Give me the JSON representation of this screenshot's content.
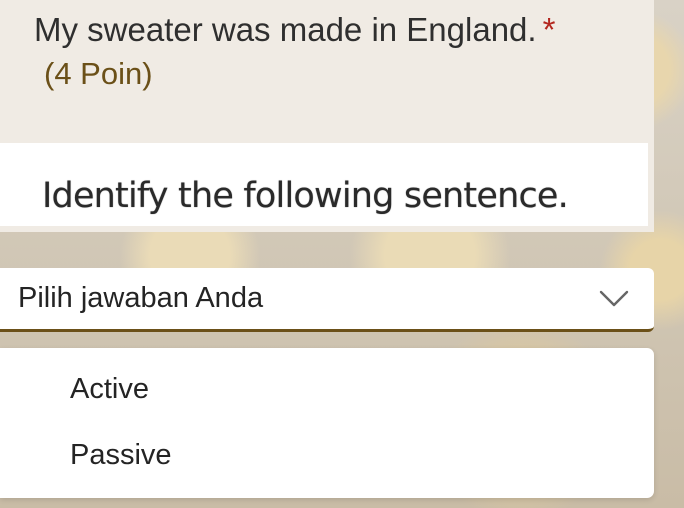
{
  "question": {
    "text": "My sweater was made in England.",
    "required_marker": "*",
    "points": "(4 Poin)"
  },
  "question_image": {
    "text": "Identify the following sentence."
  },
  "answer_select": {
    "placeholder": "Pilih jawaban Anda",
    "icon": "chevron-down-icon",
    "options": [
      {
        "label": "Active"
      },
      {
        "label": "Passive"
      }
    ]
  },
  "colors": {
    "accent": "#6b5018",
    "required": "#b3261e",
    "card_background": "#f0ebe4"
  }
}
